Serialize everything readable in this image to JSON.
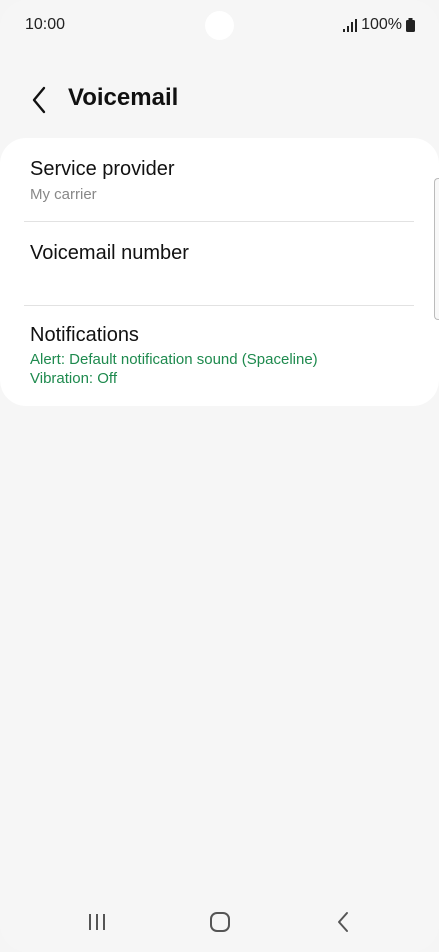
{
  "status_bar": {
    "time": "10:00",
    "battery": "100%",
    "icons": [
      "signal-icon",
      "battery-icon"
    ]
  },
  "header": {
    "title": "Voicemail",
    "back_icon": "chevron-left-icon"
  },
  "settings": {
    "service_provider": {
      "title": "Service provider",
      "value": "My carrier"
    },
    "voicemail_number": {
      "title": "Voicemail number"
    },
    "notifications": {
      "title": "Notifications",
      "alert": "Alert: Default notification sound (Spaceline)",
      "vibration": "Vibration: Off"
    }
  },
  "nav_bar": {
    "icons": [
      "recents-icon",
      "home-icon",
      "back-icon"
    ]
  },
  "colors": {
    "accent_green": "#1e8a4e",
    "background": "#f6f6f6",
    "card": "#ffffff"
  }
}
